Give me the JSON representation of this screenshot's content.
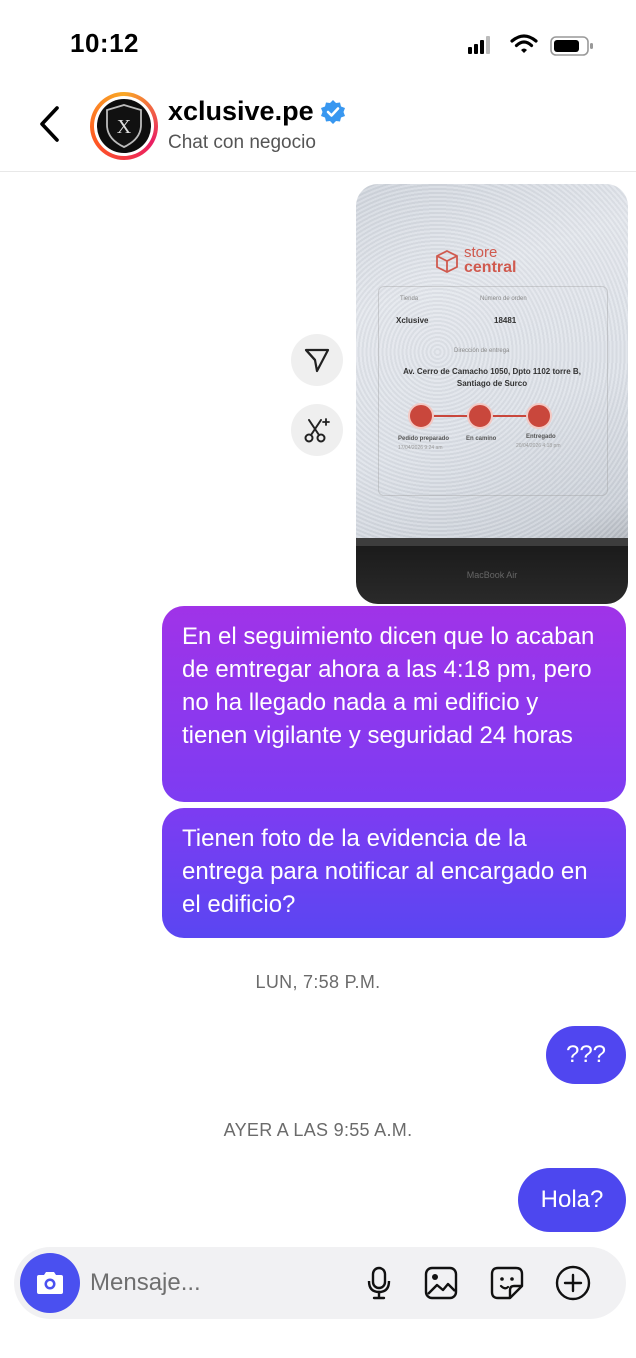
{
  "status_bar": {
    "time": "10:12"
  },
  "header": {
    "name": "xclusive.pe",
    "subtitle": "Chat con negocio",
    "avatar_letter": "X"
  },
  "shared_image": {
    "logo_store": "store",
    "logo_central": "central",
    "tienda_label": "Tienda",
    "tienda_value": "Xclusive",
    "orden_label": "Número de orden",
    "orden_value": "18481",
    "direccion_label": "Dirección de entrega",
    "direccion_value_1": "Av. Cerro de Camacho 1050, Dpto 1102 torre B,",
    "direccion_value_2": "Santiago de Surco",
    "step1_label": "Pedido preparado",
    "step1_date": "17/04/2026 9:24 am",
    "step2_label": "En camino",
    "step3_label": "Entregado",
    "step3_date": "20/04/2026 4:18 pm",
    "laptop_label": "MacBook Air"
  },
  "messages": [
    {
      "text": "En el seguimiento dicen que lo acaban de emtregar ahora a las 4:18 pm, pero no ha llegado nada a mi edificio y tienen vigilante y seguridad 24 horas"
    },
    {
      "text": "Tienen foto de la evidencia de la entrega para notificar al encargado en el edificio?"
    },
    {
      "text": "???"
    },
    {
      "text": "Hola?"
    }
  ],
  "timestamps": [
    "LUN, 7:58 P.M.",
    "AYER A LAS 9:55 A.M."
  ],
  "composer": {
    "placeholder": "Mensaje..."
  },
  "colors": {
    "accent": "#4a50f0",
    "bubble_top": "#a033e8",
    "verified": "#3897f0"
  }
}
